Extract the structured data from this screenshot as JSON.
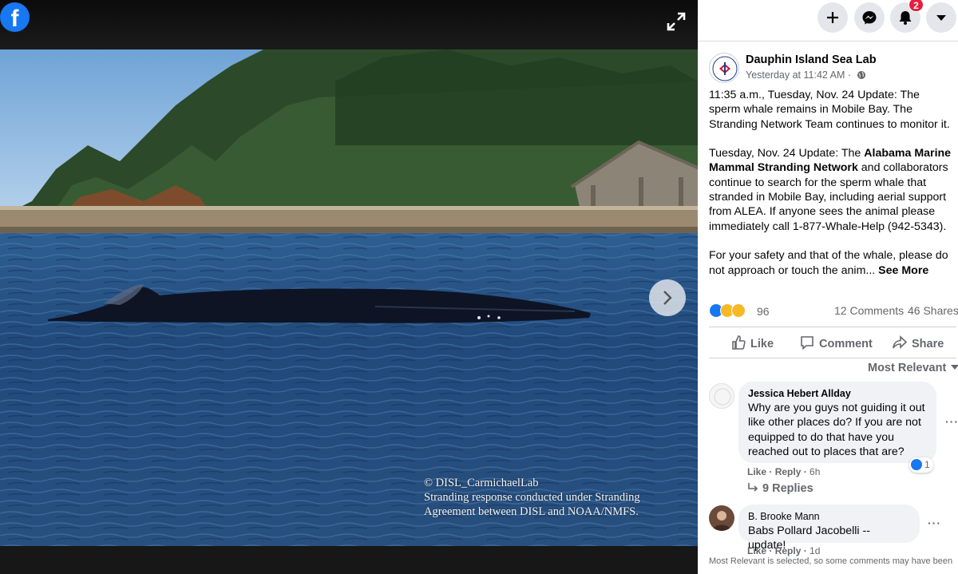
{
  "viewer": {
    "logo_letter": "f",
    "watermark_line1": "© DISL_CarmichaelLab",
    "watermark_line2": "Stranding response conducted under Stranding",
    "watermark_line3": "Agreement between DISL and NOAA/NMFS."
  },
  "top_actions": {
    "icons": [
      "plus-icon",
      "messenger-icon",
      "bell-icon",
      "caret-down-icon"
    ],
    "notification_count": "2"
  },
  "post": {
    "page_name": "Dauphin Island Sea Lab",
    "time": "Yesterday at 11:42 AM ·",
    "paragraph1": "11:35 a.m., Tuesday, Nov. 24 Update: The sperm whale remains in Mobile Bay. The Stranding Network Team continues to monitor it.",
    "paragraph2_before": "Tuesday, Nov. 24 Update: The ",
    "paragraph2_bold": "Alabama Marine Mammal Stranding Network",
    "paragraph2_after": " and collaborators continue to search for the sperm whale that stranded in Mobile Bay, including aerial support from ALEA. If anyone sees the animal please immediately call 1-877-Whale-Help (942-5343).",
    "paragraph3": "For your safety and that of the whale, please do not approach or touch the anim...",
    "see_more": "See More",
    "reaction_count": "96",
    "comments": "12 Comments",
    "shares": "46 Shares",
    "like_label": "Like",
    "comment_label": "Comment",
    "share_label": "Share",
    "sort_label": "Most Relevant"
  },
  "comments": [
    {
      "author": "Jessica Hebert Allday",
      "text": "Why are you guys not guiding it out like other places do? If you are not equipped to do that have you reached out to places that are?",
      "like": "Like",
      "reply": "Reply",
      "time": "6h",
      "reactions": "1",
      "replies": "9 Replies"
    },
    {
      "author": "B. Brooke Mann",
      "text": "Babs Pollard Jacobelli -- update!",
      "like": "Like",
      "reply": "Reply",
      "time": "1d"
    }
  ],
  "notice": "Most Relevant is selected, so some comments may have been"
}
